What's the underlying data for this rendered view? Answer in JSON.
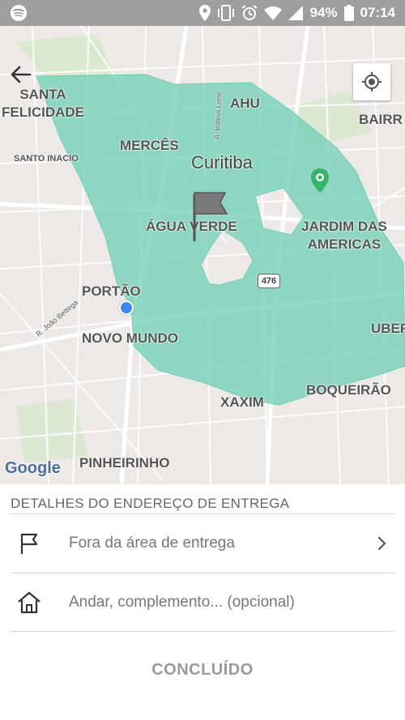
{
  "status_bar": {
    "battery": "94%",
    "time": "07:14"
  },
  "map": {
    "labels": {
      "santa_felicidade": "SANTA\nFELICIDADE",
      "ahu": "AHU",
      "bairro": "BAIRR",
      "santo_inacio": "SANTO INACIO",
      "merces": "MERCÊS",
      "curitiba": "Curitiba",
      "agua_verde": "ÁGUA VERDE",
      "jardim_das_americas": "JARDIM DAS\nAMERICAS",
      "portao": "PORTÃO",
      "novo_mundo": "NOVO MUNDO",
      "uber": "UBER",
      "boqueirao": "BOQUEIRÃO",
      "xaxim": "XAXIM",
      "pinheirinho": "PINHEIRINHO",
      "street_joao": "R. João Bettega",
      "street_mateus": "R. Mateus Leme",
      "road_476": "476"
    },
    "google_logo": "Google",
    "delivery_area_color": "#6fcfb4"
  },
  "panel": {
    "title": "DETALHES DO ENDEREÇO DE ENTREGA",
    "address_row": "Fora da área de entrega",
    "complement_placeholder": "Andar, complemento... (opcional)",
    "done_button": "CONCLUÍDO"
  }
}
